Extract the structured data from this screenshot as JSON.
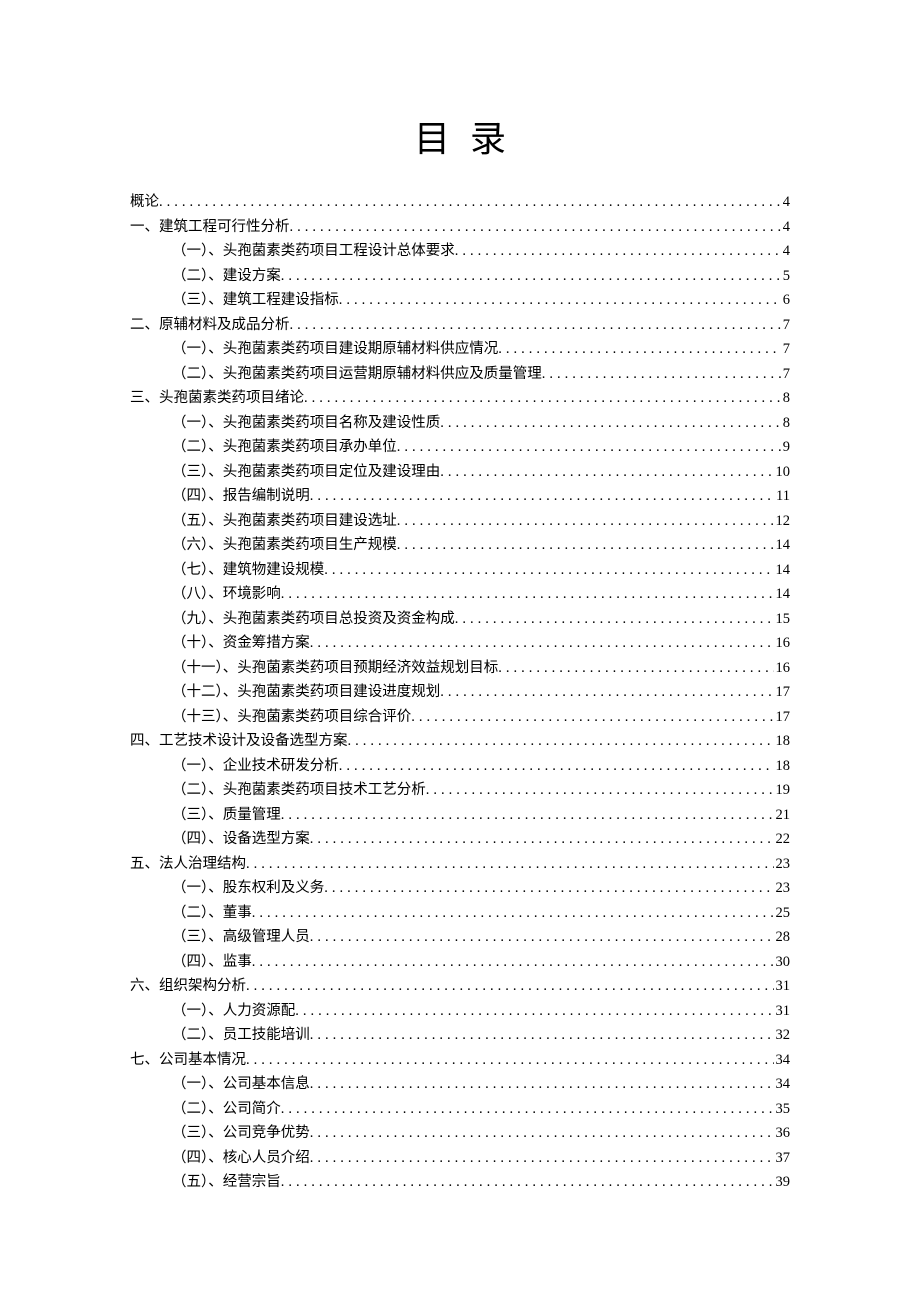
{
  "title": "目录",
  "toc": [
    {
      "indent": 0,
      "label": "概论",
      "page": "4"
    },
    {
      "indent": 0,
      "label": "一、建筑工程可行性分析",
      "page": "4"
    },
    {
      "indent": 1,
      "label": "（一）、头孢菌素类药项目工程设计总体要求",
      "page": "4"
    },
    {
      "indent": 1,
      "label": "（二）、建设方案",
      "page": "5"
    },
    {
      "indent": 1,
      "label": "（三）、建筑工程建设指标",
      "page": "6"
    },
    {
      "indent": 0,
      "label": "二、原辅材料及成品分析",
      "page": "7"
    },
    {
      "indent": 1,
      "label": "（一）、头孢菌素类药项目建设期原辅材料供应情况",
      "page": "7"
    },
    {
      "indent": 1,
      "label": "（二）、头孢菌素类药项目运营期原辅材料供应及质量管理",
      "page": "7"
    },
    {
      "indent": 0,
      "label": "三、头孢菌素类药项目绪论",
      "page": "8"
    },
    {
      "indent": 1,
      "label": "（一）、头孢菌素类药项目名称及建设性质",
      "page": "8"
    },
    {
      "indent": 1,
      "label": "（二）、头孢菌素类药项目承办单位",
      "page": "9"
    },
    {
      "indent": 1,
      "label": "（三）、头孢菌素类药项目定位及建设理由",
      "page": "10"
    },
    {
      "indent": 1,
      "label": "（四）、报告编制说明",
      "page": "11"
    },
    {
      "indent": 1,
      "label": "（五）、头孢菌素类药项目建设选址",
      "page": "12"
    },
    {
      "indent": 1,
      "label": "（六）、头孢菌素类药项目生产规模",
      "page": "14"
    },
    {
      "indent": 1,
      "label": "（七）、建筑物建设规模",
      "page": "14"
    },
    {
      "indent": 1,
      "label": "（八）、环境影响",
      "page": "14"
    },
    {
      "indent": 1,
      "label": "（九）、头孢菌素类药项目总投资及资金构成",
      "page": "15"
    },
    {
      "indent": 1,
      "label": "（十）、资金筹措方案",
      "page": "16"
    },
    {
      "indent": 1,
      "label": "（十一）、头孢菌素类药项目预期经济效益规划目标",
      "page": "16"
    },
    {
      "indent": 1,
      "label": "（十二）、头孢菌素类药项目建设进度规划",
      "page": "17"
    },
    {
      "indent": 1,
      "label": "（十三）、头孢菌素类药项目综合评价",
      "page": "17"
    },
    {
      "indent": 0,
      "label": "四、工艺技术设计及设备选型方案",
      "page": "18"
    },
    {
      "indent": 1,
      "label": "（一）、企业技术研发分析",
      "page": "18"
    },
    {
      "indent": 1,
      "label": "（二）、头孢菌素类药项目技术工艺分析",
      "page": "19"
    },
    {
      "indent": 1,
      "label": "（三）、质量管理",
      "page": "21"
    },
    {
      "indent": 1,
      "label": "（四）、设备选型方案",
      "page": "22"
    },
    {
      "indent": 0,
      "label": "五、法人治理结构",
      "page": "23"
    },
    {
      "indent": 1,
      "label": "（一）、股东权利及义务",
      "page": "23"
    },
    {
      "indent": 1,
      "label": "（二）、董事",
      "page": "25"
    },
    {
      "indent": 1,
      "label": "（三）、高级管理人员",
      "page": "28"
    },
    {
      "indent": 1,
      "label": "（四）、监事",
      "page": "30"
    },
    {
      "indent": 0,
      "label": "六、组织架构分析",
      "page": "31"
    },
    {
      "indent": 1,
      "label": "（一）、人力资源配",
      "page": "31"
    },
    {
      "indent": 1,
      "label": "（二）、员工技能培训",
      "page": "32"
    },
    {
      "indent": 0,
      "label": "七、公司基本情况",
      "page": "34"
    },
    {
      "indent": 1,
      "label": "（一）、公司基本信息",
      "page": "34"
    },
    {
      "indent": 1,
      "label": "（二）、公司简介",
      "page": "35"
    },
    {
      "indent": 1,
      "label": "（三）、公司竞争优势",
      "page": "36"
    },
    {
      "indent": 1,
      "label": "（四）、核心人员介绍",
      "page": "37"
    },
    {
      "indent": 1,
      "label": "（五）、经营宗旨",
      "page": "39"
    }
  ]
}
